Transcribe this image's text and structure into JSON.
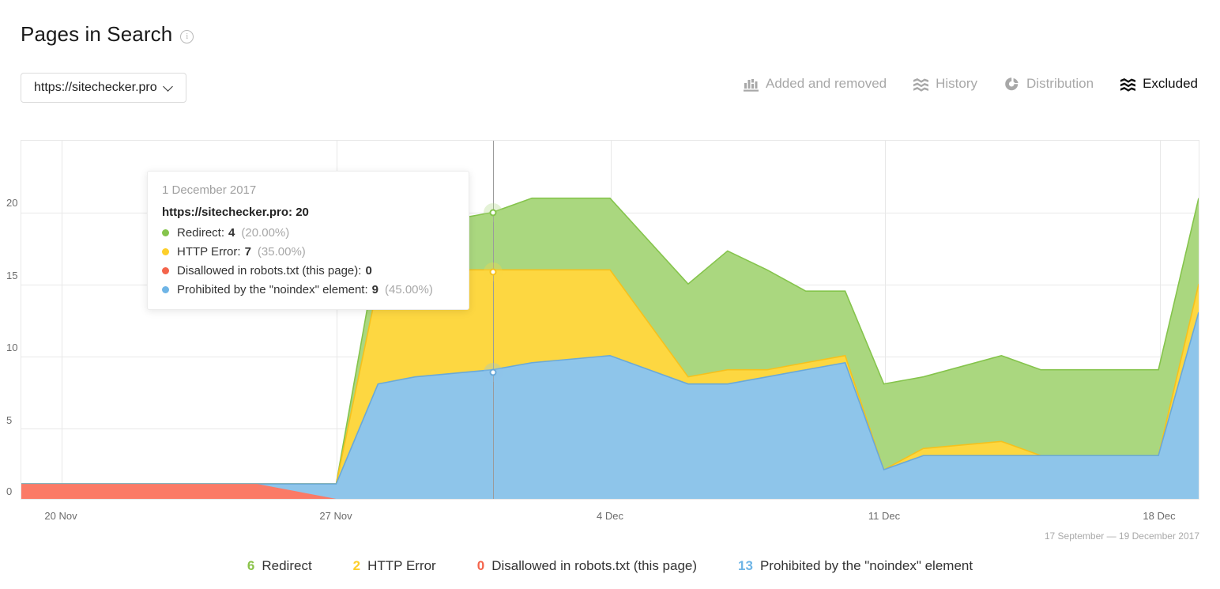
{
  "header": {
    "title": "Pages in Search",
    "info_icon": "info-icon",
    "site_selector": {
      "value": "https://sitechecker.pro",
      "chevron": "chevron-down-icon"
    }
  },
  "toolbar": {
    "items": [
      {
        "label": "Added and removed",
        "icon": "bar-chart-icon",
        "active": false
      },
      {
        "label": "History",
        "icon": "layers-wave-icon",
        "active": false
      },
      {
        "label": "Distribution",
        "icon": "donut-chart-icon",
        "active": false
      },
      {
        "label": "Excluded",
        "icon": "layers-wave-icon",
        "active": true
      }
    ]
  },
  "tooltip": {
    "date": "1 December 2017",
    "total_label": "https://sitechecker.pro:",
    "total_value": "20",
    "rows": [
      {
        "color": "#85c44c",
        "label": "Redirect:",
        "value": "4",
        "pct": "(20.00%)"
      },
      {
        "color": "#fdcf2b",
        "label": "HTTP Error:",
        "value": "7",
        "pct": "(35.00%)"
      },
      {
        "color": "#f4644b",
        "label": "Disallowed in robots.txt (this page):",
        "value": "0",
        "pct": ""
      },
      {
        "color": "#6fb5e6",
        "label": "Prohibited by the \"noindex\" element:",
        "value": "9",
        "pct": "(45.00%)"
      }
    ]
  },
  "legend": [
    {
      "count": "6",
      "label": "Redirect",
      "color": "#8bc34a"
    },
    {
      "count": "2",
      "label": "HTTP Error",
      "color": "#fdcf2b"
    },
    {
      "count": "0",
      "label": "Disallowed in robots.txt (this page)",
      "color": "#f4644b"
    },
    {
      "count": "13",
      "label": "Prohibited by the \"noindex\" element",
      "color": "#6fb5e6"
    }
  ],
  "chart_footer": {
    "date_range": "17 September — 19 December 2017"
  },
  "colors": {
    "redirect": "#aad77f",
    "http_error": "#fdd741",
    "disallowed": "#fb7a66",
    "noindex": "#8ec5ea",
    "redirect_line": "#85c44c",
    "http_error_line": "#f5c11d",
    "disallowed_line": "#f4644b",
    "noindex_line": "#6aa9d8",
    "grid": "#e8e8e8",
    "hover_line": "#9b9b9b"
  },
  "chart_data": {
    "type": "area",
    "stacked": true,
    "title": "Pages in Search — Excluded",
    "xlabel": "",
    "ylabel": "",
    "ylim": [
      0,
      22
    ],
    "yticks": [
      0,
      5,
      10,
      15,
      20
    ],
    "xticks": [
      "20 Nov",
      "27 Nov",
      "4 Dec",
      "11 Dec",
      "18 Dec"
    ],
    "grid": true,
    "legend_position": "bottom",
    "annotation": "Hover marker at 1 December 2017",
    "x": [
      "18 Nov",
      "20 Nov",
      "23 Nov",
      "25 Nov",
      "27 Nov",
      "29 Nov",
      "1 Dec",
      "2 Dec",
      "4 Dec",
      "6 Dec",
      "7 Dec",
      "9 Dec",
      "10 Dec",
      "11 Dec",
      "13 Dec",
      "15 Dec",
      "16 Dec",
      "18 Dec",
      "19 Dec"
    ],
    "series": [
      {
        "name": "Prohibited by the \"noindex\" element",
        "color": "#8ec5ea",
        "values": [
          0,
          0,
          0,
          0,
          8,
          8.5,
          9,
          9.5,
          10,
          8,
          8.5,
          9,
          10,
          2,
          2.5,
          3,
          3,
          3,
          13
        ]
      },
      {
        "name": "Disallowed in robots.txt (this page)",
        "color": "#fb7a66",
        "values": [
          1,
          1,
          1,
          1,
          0,
          0,
          0,
          0,
          0,
          0,
          0,
          0,
          0,
          0,
          0,
          0,
          0,
          0,
          0
        ]
      },
      {
        "name": "HTTP Error",
        "color": "#fdd741",
        "values": [
          0,
          0,
          0,
          0,
          7,
          7.5,
          7,
          6.5,
          6,
          0.5,
          0.5,
          0.5,
          0.5,
          0,
          1,
          1,
          0,
          0,
          2
        ]
      },
      {
        "name": "Redirect",
        "color": "#aad77f",
        "values": [
          0,
          0,
          0,
          0,
          2.5,
          3,
          4,
          5,
          5,
          6.5,
          8.5,
          6,
          4,
          6,
          5,
          6,
          6,
          6,
          6
        ]
      }
    ],
    "stack_tops": {
      "noindex": [
        0,
        0,
        0,
        0,
        8,
        8.5,
        9,
        9.5,
        10,
        8,
        8.5,
        9,
        10,
        2,
        2.5,
        3,
        3,
        3,
        13
      ],
      "http_error": [
        1,
        1,
        1,
        1,
        15,
        16,
        16,
        16,
        16,
        8.5,
        9,
        9.5,
        10.5,
        2,
        3.5,
        4,
        3,
        3,
        15
      ],
      "redirect": [
        1,
        1,
        1,
        1,
        17.5,
        19,
        20,
        21,
        21,
        15,
        17.5,
        15.5,
        14.5,
        8,
        8.5,
        10,
        9,
        9,
        21
      ]
    }
  }
}
